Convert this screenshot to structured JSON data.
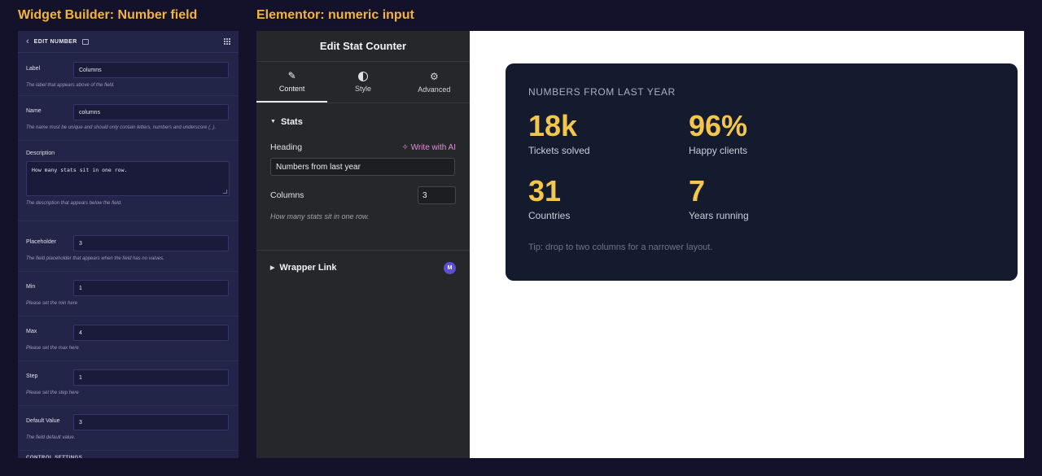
{
  "headings": {
    "left": "Widget Builder: Number field",
    "right": "Elementor: numeric input"
  },
  "widget_builder": {
    "title": "EDIT NUMBER",
    "fields": [
      {
        "label": "Label",
        "value": "Columns",
        "help": "The label that appears above of the field."
      },
      {
        "label": "Name",
        "value": "columns",
        "help": "The name must be unique and should only contain letters, numbers and underscore (_)."
      }
    ],
    "description": {
      "label": "Description",
      "value": "How many stats sit in one row.",
      "help": "The description that appears below the field."
    },
    "settings": [
      {
        "label": "Placeholder",
        "value": "3",
        "help": "The field placeholder that appears when the field has no values."
      },
      {
        "label": "Min",
        "value": "1",
        "help": "Please set the min here"
      },
      {
        "label": "Max",
        "value": "4",
        "help": "Please set the max here"
      },
      {
        "label": "Step",
        "value": "1",
        "help": "Please set the step here"
      },
      {
        "label": "Default Value",
        "value": "3",
        "help": "The field default value."
      }
    ],
    "next_section": "CONTROL SETTINGS"
  },
  "elementor": {
    "title": "Edit Stat Counter",
    "tabs": [
      {
        "label": "Content",
        "icon": "pencil-icon"
      },
      {
        "label": "Style",
        "icon": "contrast-icon"
      },
      {
        "label": "Advanced",
        "icon": "gear-icon"
      }
    ],
    "stats_section": {
      "title": "Stats",
      "heading_label": "Heading",
      "ai_button": "Write with AI",
      "heading_value": "Numbers from last year",
      "columns_label": "Columns",
      "columns_value": "3",
      "columns_help": "How many stats sit in one row."
    },
    "wrapper_section": {
      "title": "Wrapper Link",
      "badge": "M"
    }
  },
  "preview": {
    "title": "NUMBERS FROM LAST YEAR",
    "stats": [
      {
        "value": "18k",
        "label": "Tickets solved"
      },
      {
        "value": "96%",
        "label": "Happy clients"
      },
      {
        "value": "31",
        "label": "Countries"
      },
      {
        "value": "7",
        "label": "Years running"
      }
    ],
    "tip": "Tip: drop to two columns for a narrower layout."
  }
}
